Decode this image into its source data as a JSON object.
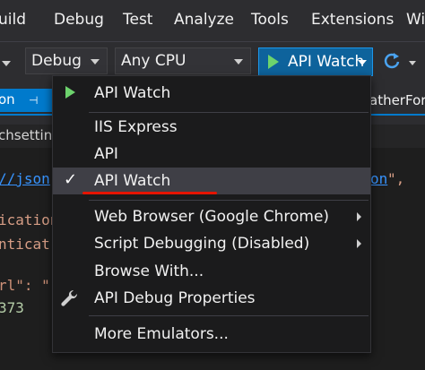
{
  "menubar": {
    "items": [
      "uild",
      "Debug",
      "Test",
      "Analyze",
      "Tools",
      "Extensions",
      "Wi"
    ]
  },
  "toolbar": {
    "config_value": "Debug",
    "platform_value": "Any CPU",
    "run_label": "API Watch"
  },
  "tabs": {
    "active_tab": "on",
    "pin_glyph": "⊣",
    "right_tab": "atherFor",
    "sub_tab": "chsetting"
  },
  "code": {
    "line1_link": "//json",
    "line1_suffix": "on",
    "line1_comma": "\",",
    "line2": "ication",
    "line3": "nticat",
    "line4_key": "rl\": \"",
    "line5": "373"
  },
  "dropdown": {
    "items": [
      {
        "label": "API Watch",
        "icon": "play-icon"
      },
      {
        "label": "IIS Express"
      },
      {
        "label": "API"
      },
      {
        "label": "API Watch",
        "icon": "checkmark-icon",
        "checked": true
      },
      {
        "label": "Web Browser (Google Chrome)",
        "submenu": true
      },
      {
        "label": "Script Debugging (Disabled)",
        "submenu": true
      },
      {
        "label": "Browse With..."
      },
      {
        "label": "API Debug Properties",
        "icon": "wrench-icon"
      },
      {
        "label": "More Emulators..."
      }
    ],
    "check_glyph": "✓"
  },
  "colors": {
    "accent": "#007acc",
    "run_button": "#0e639c",
    "play_green": "#6dd36d",
    "highlight_underline": "#e51400",
    "menu_bg": "#1b1b1c"
  }
}
